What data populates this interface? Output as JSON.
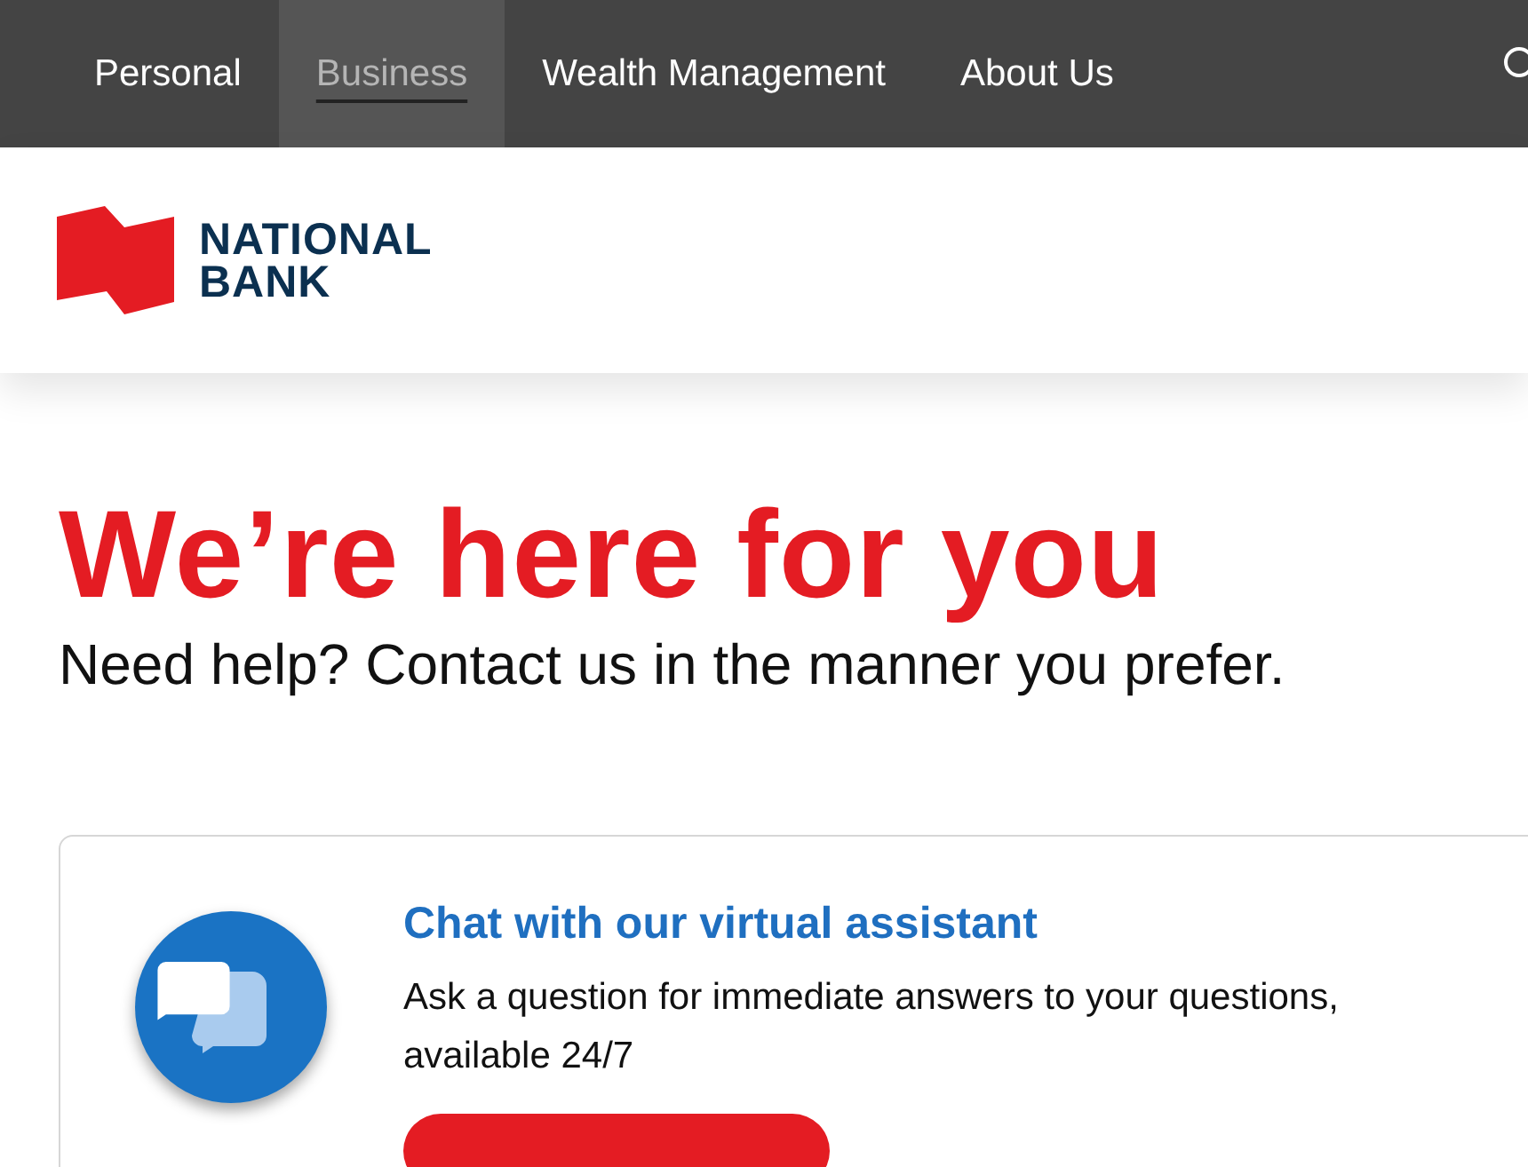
{
  "nav": {
    "items": [
      {
        "label": "Personal",
        "selected": false
      },
      {
        "label": "Business",
        "selected": true
      },
      {
        "label": "Wealth Management",
        "selected": false
      },
      {
        "label": "About Us",
        "selected": false
      }
    ]
  },
  "logo": {
    "lines": [
      "NATIONAL",
      "BANK"
    ]
  },
  "hero": {
    "title": "We’re here for you",
    "subtitle": "Need help? Contact us in the manner you prefer."
  },
  "card": {
    "title": "Chat with our virtual assistant",
    "text": "Ask a question for immediate answers to your questions, available 24/7"
  }
}
